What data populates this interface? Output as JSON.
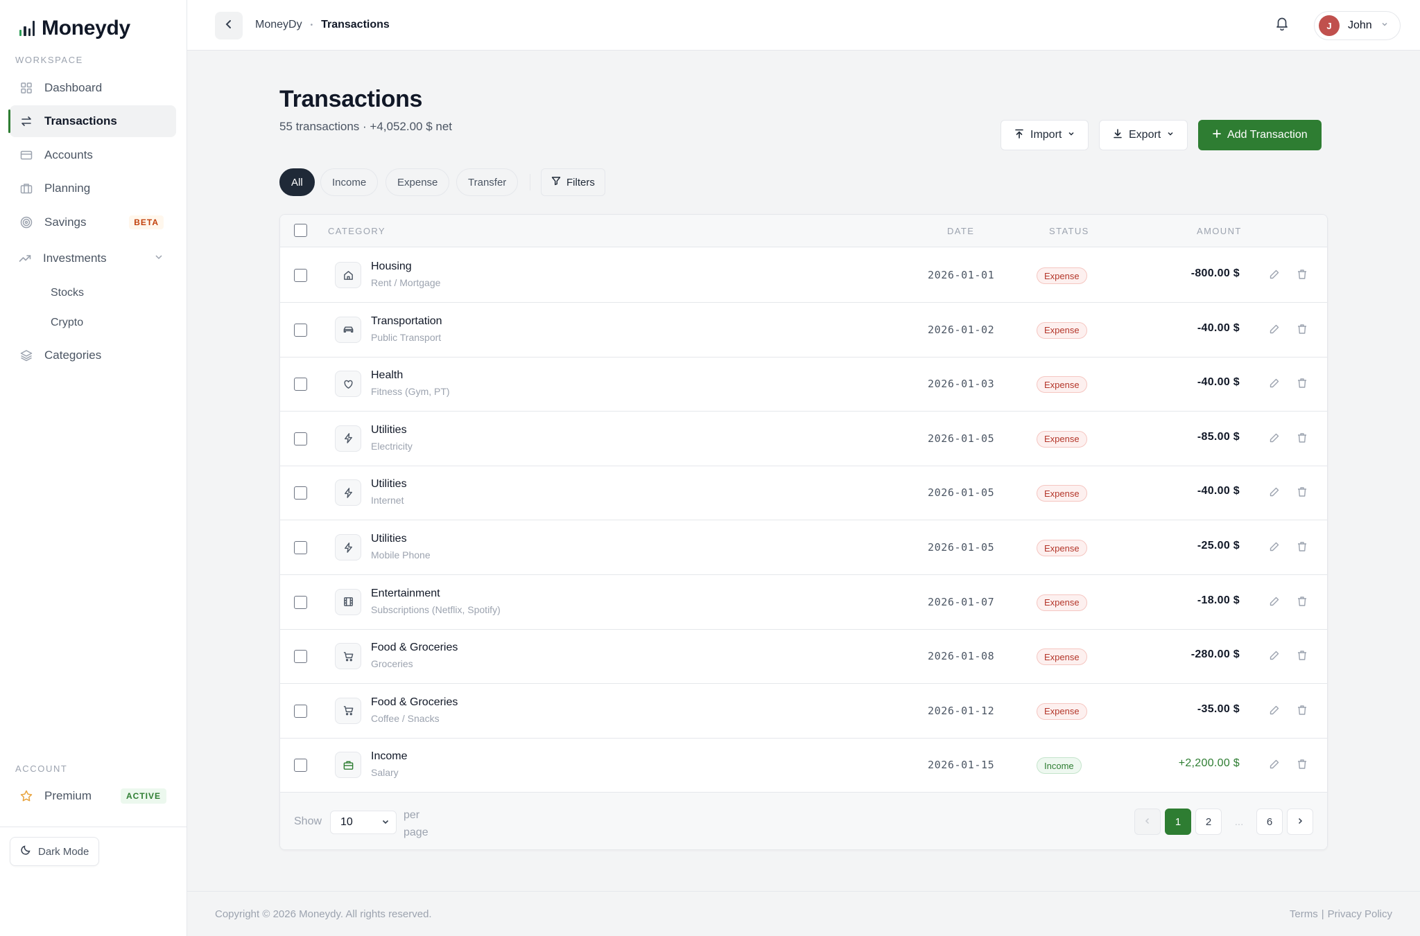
{
  "brand": {
    "name": "Moneydy"
  },
  "sidebar": {
    "workspace_label": "WORKSPACE",
    "items": [
      {
        "label": "Dashboard",
        "icon": "grid-icon"
      },
      {
        "label": "Transactions",
        "icon": "transfer-icon"
      },
      {
        "label": "Accounts",
        "icon": "card-icon"
      },
      {
        "label": "Planning",
        "icon": "briefcase-icon"
      },
      {
        "label": "Savings",
        "icon": "target-icon",
        "badge": "BETA"
      },
      {
        "label": "Investments",
        "icon": "trending-up-icon"
      }
    ],
    "sub_items": [
      "Stocks",
      "Crypto"
    ],
    "categories_label": "Categories",
    "account_label": "ACCOUNT",
    "premium_label": "Premium",
    "premium_badge": "ACTIVE",
    "dark_mode_label": "Dark Mode"
  },
  "topbar": {
    "breadcrumb_parent": "MoneyDy",
    "breadcrumb_sep": "•",
    "breadcrumb_current": "Transactions",
    "user_initial": "J",
    "user_name": "John"
  },
  "page": {
    "title": "Transactions",
    "subtitle": "55 transactions · +4,052.00 $ net",
    "import_label": "Import",
    "export_label": "Export",
    "add_label": "Add Transaction"
  },
  "filters": {
    "pills": [
      "All",
      "Income",
      "Expense",
      "Transfer"
    ],
    "active": "All",
    "filters_label": "Filters"
  },
  "table": {
    "headers": {
      "category": "CATEGORY",
      "date": "DATE",
      "status": "STATUS",
      "amount": "AMOUNT"
    },
    "rows": [
      {
        "category": "Housing",
        "subcategory": "Rent / Mortgage",
        "icon": "home-icon",
        "date": "2026-01-01",
        "status": "Expense",
        "amount": "-800.00 $"
      },
      {
        "category": "Transportation",
        "subcategory": "Public Transport",
        "icon": "car-icon",
        "date": "2026-01-02",
        "status": "Expense",
        "amount": "-40.00 $"
      },
      {
        "category": "Health",
        "subcategory": "Fitness (Gym, PT)",
        "icon": "heart-icon",
        "date": "2026-01-03",
        "status": "Expense",
        "amount": "-40.00 $"
      },
      {
        "category": "Utilities",
        "subcategory": "Electricity",
        "icon": "bolt-icon",
        "date": "2026-01-05",
        "status": "Expense",
        "amount": "-85.00 $"
      },
      {
        "category": "Utilities",
        "subcategory": "Internet",
        "icon": "bolt-icon",
        "date": "2026-01-05",
        "status": "Expense",
        "amount": "-40.00 $"
      },
      {
        "category": "Utilities",
        "subcategory": "Mobile Phone",
        "icon": "bolt-icon",
        "date": "2026-01-05",
        "status": "Expense",
        "amount": "-25.00 $"
      },
      {
        "category": "Entertainment",
        "subcategory": "Subscriptions (Netflix, Spotify)",
        "icon": "film-icon",
        "date": "2026-01-07",
        "status": "Expense",
        "amount": "-18.00 $"
      },
      {
        "category": "Food & Groceries",
        "subcategory": "Groceries",
        "icon": "cart-icon",
        "date": "2026-01-08",
        "status": "Expense",
        "amount": "-280.00 $"
      },
      {
        "category": "Food & Groceries",
        "subcategory": "Coffee / Snacks",
        "icon": "cart-icon",
        "date": "2026-01-12",
        "status": "Expense",
        "amount": "-35.00 $"
      },
      {
        "category": "Income",
        "subcategory": "Salary",
        "icon": "briefcase-icon",
        "date": "2026-01-15",
        "status": "Income",
        "amount": "+2,200.00 $"
      }
    ]
  },
  "pagination": {
    "show_label": "Show",
    "per_page_value": "10",
    "per_page_label": "per page",
    "pages": [
      "1",
      "2",
      "...",
      "6"
    ],
    "current": "1"
  },
  "footer": {
    "copyright": "Copyright © 2026 Moneydy. All rights reserved.",
    "terms": "Terms",
    "separator": "|",
    "privacy": "Privacy Policy"
  },
  "colors": {
    "accent": "#2e7d32",
    "expense": "#b4362a",
    "income": "#2e7d32",
    "avatar": "#c0504d"
  }
}
